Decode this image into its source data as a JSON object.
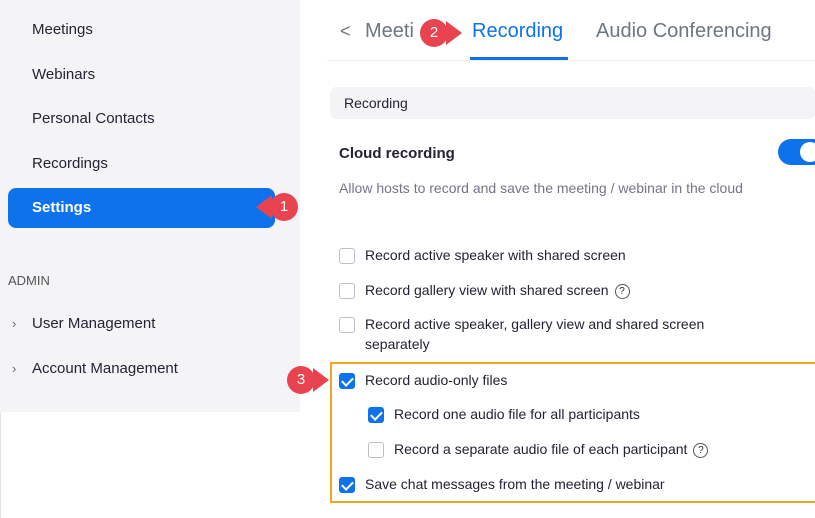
{
  "sidebar": {
    "items": [
      {
        "label": "Meetings"
      },
      {
        "label": "Webinars"
      },
      {
        "label": "Personal Contacts"
      },
      {
        "label": "Recordings"
      },
      {
        "label": "Settings"
      }
    ],
    "admin_heading": "ADMIN",
    "admin_items": [
      {
        "label": "User Management"
      },
      {
        "label": "Account Management"
      }
    ]
  },
  "tabs": {
    "back_icon": "chevron-left-icon",
    "items": [
      {
        "label": "Meeti"
      },
      {
        "label": "Recording"
      },
      {
        "label": "Audio Conferencing"
      }
    ]
  },
  "section": {
    "label": "Recording"
  },
  "cloud": {
    "title": "Cloud recording",
    "description": "Allow hosts to record and save the meeting / webinar in the cloud",
    "enabled": true
  },
  "options": [
    {
      "label": "Record active speaker with shared screen",
      "checked": false
    },
    {
      "label": "Record gallery view with shared screen",
      "checked": false
    },
    {
      "label": "Record active speaker, gallery view and shared screen separately",
      "checked": false
    },
    {
      "label": "Record audio-only files",
      "checked": true
    },
    {
      "label": "Record one audio file for all participants",
      "checked": true
    },
    {
      "label": "Record a separate audio file of each participant",
      "checked": false
    },
    {
      "label": "Save chat messages from the meeting / webinar",
      "checked": true
    }
  ],
  "annotations": {
    "steps": [
      "1",
      "2",
      "3"
    ],
    "badge_color": "#e8434f",
    "highlight_color": "#f2a51e"
  },
  "colors": {
    "accent": "#0e72ed"
  }
}
